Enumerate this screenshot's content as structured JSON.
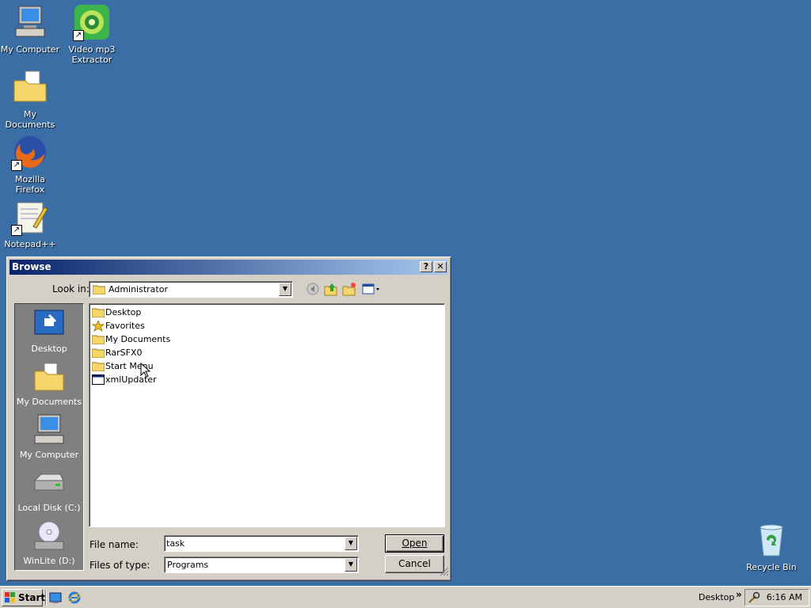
{
  "desktop": {
    "icons": [
      {
        "label": "My Computer",
        "icon": "my-computer-icon"
      },
      {
        "label": "Video mp3 Extractor",
        "icon": "video-mp3-extractor-icon"
      },
      {
        "label": "My Documents",
        "icon": "my-documents-icon"
      },
      {
        "label": "Mozilla Firefox",
        "icon": "firefox-icon"
      },
      {
        "label": "Notepad++",
        "icon": "notepadpp-icon"
      },
      {
        "label": "Recycle Bin",
        "icon": "recycle-bin-icon"
      }
    ]
  },
  "dialog": {
    "title": "Browse",
    "help_label": "?",
    "close_label": "✕",
    "look_in_label": "Look in:",
    "look_in_value": "Administrator",
    "places": [
      {
        "label": "Desktop",
        "icon": "desktop-icon"
      },
      {
        "label": "My Documents",
        "icon": "my-documents-icon"
      },
      {
        "label": "My Computer",
        "icon": "my-computer-icon"
      },
      {
        "label": "Local Disk (C:)",
        "icon": "local-disk-icon"
      },
      {
        "label": "WinLite (D:)",
        "icon": "cd-drive-icon"
      }
    ],
    "files": [
      {
        "name": "Desktop",
        "icon": "folder-icon"
      },
      {
        "name": "Favorites",
        "icon": "favorites-star-icon"
      },
      {
        "name": "My Documents",
        "icon": "folder-icon"
      },
      {
        "name": "RarSFX0",
        "icon": "folder-icon"
      },
      {
        "name": "Start Menu",
        "icon": "folder-icon"
      },
      {
        "name": "xmlUpdater",
        "icon": "application-icon"
      }
    ],
    "file_name_label": "File name:",
    "file_name_value": "task",
    "file_type_label": "Files of type:",
    "file_type_value": "Programs",
    "open_label": "Open",
    "cancel_label": "Cancel"
  },
  "taskbar": {
    "start_label": "Start",
    "toolbar_label": "Desktop",
    "chevron": "»",
    "clock": "6:16 AM"
  },
  "colors": {
    "desktop_bg": "#3a6ea5",
    "titlebar_start": "#0a246a",
    "titlebar_end": "#a6caf0",
    "face": "#d4d0c8"
  }
}
